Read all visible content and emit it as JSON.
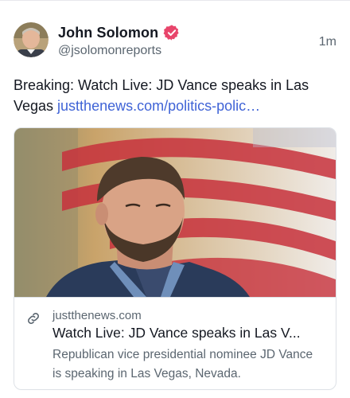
{
  "post": {
    "author": {
      "display_name": "John Solomon",
      "handle": "@jsolomonreports",
      "avatar_icon": "avatar-photo",
      "verified_icon": "verified-badge-icon",
      "verified_color": "#e8456b"
    },
    "timestamp": "1m",
    "text": "Breaking: Watch Live: JD Vance speaks in Las Vegas ",
    "link_text": "justthenews.com/politics-polic…",
    "link_color": "#3f63d6"
  },
  "card": {
    "image_icon": "article-photo",
    "link_icon": "link-icon",
    "domain": "justthenews.com",
    "title": "Watch Live: JD Vance speaks in Las V...",
    "description": "Republican vice presidential nominee JD Vance is speaking in Las Vegas, Nevada."
  }
}
